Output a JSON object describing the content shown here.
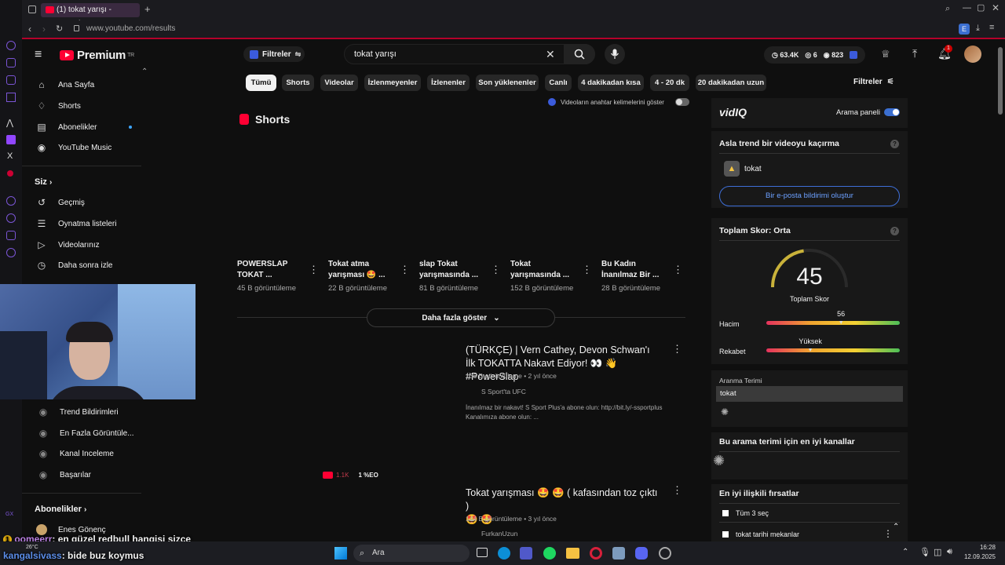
{
  "browser": {
    "tab_title": "(1) tokat yarışı - YouTube",
    "url": "www.youtube.com/results"
  },
  "masthead": {
    "logo_text": "Premium",
    "logo_region": "TR",
    "filters_label": "Filtreler",
    "search_value": "tokat yarışı",
    "stats": {
      "views": "63.4K",
      "likes": "6",
      "eye": "823"
    },
    "notification_count": "1"
  },
  "nav": {
    "main": [
      "Ana Sayfa",
      "Shorts",
      "Abonelikler",
      "YouTube Music"
    ],
    "you_heading": "Siz",
    "you": [
      "Geçmiş",
      "Oynatma listeleri",
      "Videolarınız",
      "Daha sonra izle"
    ],
    "vidiq": [
      "Trend Bildirimleri",
      "En Fazla Görüntüle...",
      "Kanal Inceleme",
      "Başarılar"
    ],
    "subs_heading": "Abonelikler",
    "subs": [
      "Enes Gönenç"
    ]
  },
  "chips": [
    "Tümü",
    "Shorts",
    "Videolar",
    "İzlenmeyenler",
    "İzlenenler",
    "Son yüklenenler",
    "Canlı",
    "4 dakikadan kısa",
    "4 - 20 dk",
    "20 dakikadan uzun"
  ],
  "filters_right": "Filtreler",
  "keyword_toggle_label": "Videoların anahtar kelimelerini göster",
  "shorts": {
    "heading": "Shorts",
    "items": [
      {
        "title1": "POWERSLAP",
        "title2": "TOKAT ...",
        "views": "45 B görüntüleme"
      },
      {
        "title1": "Tokat atma",
        "title2": "yarışması 🤩 ...",
        "views": "22 B görüntüleme"
      },
      {
        "title1": "slap Tokat",
        "title2": "yarışmasında ...",
        "views": "81 B görüntüleme"
      },
      {
        "title1": "Tokat",
        "title2": "yarışmasında ...",
        "views": "152 B görüntüleme"
      },
      {
        "title1": "Bu Kadın",
        "title2": "İnanılmaz Bir ...",
        "views": "28 B görüntüleme"
      }
    ],
    "more_label": "Daha fazla göster"
  },
  "videos": [
    {
      "title": "(TÜRKÇE) | Vern Cathey, Devon Schwan'ı İlk TOKATTA Nakavt Ediyor! 👀 👋 #PowerSlap",
      "meta": "136 B görüntüleme • 2 yıl önce",
      "channel": "S Sport'ta UFC",
      "desc": "İnanılmaz bir nakavt! S Sport Plus'a abone olun: http://bit.ly/-ssportplus Kanalımıza abone olun: ...",
      "badge_count": "1.1K",
      "badge_score": "1 %EO"
    },
    {
      "title_line1": "Tokat yarışması 🤩 🤩 ( kafasından toz çıktı )",
      "title_line2": "🤩 🤩",
      "meta": "144 B görüntüleme • 3 yıl önce",
      "channel": "FurkanUzun"
    }
  ],
  "vidiq": {
    "brand": "vidIQ",
    "panel_toggle_label": "Arama paneli",
    "trend_title": "Asla trend bir videoyu kaçırma",
    "trend_keyword": "tokat",
    "email_btn": "Bir e-posta bildirimi oluştur",
    "score_title": "Toplam Skor: Orta",
    "score_value": "45",
    "score_label": "Toplam Skor",
    "gauge_fraction": 0.45,
    "volume_label": "Hacim",
    "volume_value": "56",
    "volume_fraction": 0.56,
    "competition_label": "Rekabet",
    "competition_value": "Yüksek",
    "competition_fraction": 0.33,
    "search_term_label": "Aranma Terimi",
    "search_term_value": "tokat",
    "best_channels_title": "Bu arama terimi için en iyi kanallar",
    "opportunities_title": "En iyi ilişkili fırsatlar",
    "select_all": "Tüm 3 seç",
    "opportunity_1": "tokat tarihi mekanlar"
  },
  "chat": [
    {
      "user": "oomeerr",
      "msg": ": en güzel redbull hangisi sizce",
      "color": "#b87fe0"
    },
    {
      "user": "kangalsivass",
      "msg": ": bide buz koymus",
      "color": "#5b8de8"
    }
  ],
  "taskbar": {
    "search": "Ara",
    "weather": "26°C",
    "time": "16:28",
    "date": "12.09.2025"
  },
  "colors": {
    "accent": "#ff0033",
    "vidiq_blue": "#3ea6ff",
    "bg": "#0f0f0f"
  }
}
